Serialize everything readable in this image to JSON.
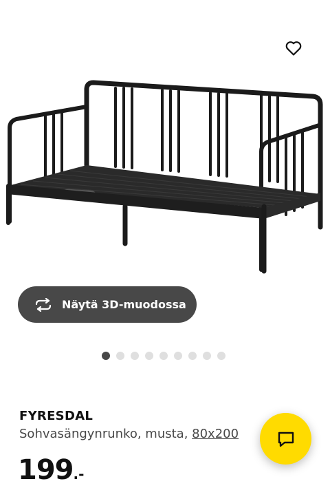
{
  "gallery": {
    "image_alt": "FYRESDAL sofa bed frame, black",
    "favourite_icon": "heart-outline-icon",
    "view_3d": {
      "icon": "rotate-3d-icon",
      "label": "Näytä 3D-muodossa"
    },
    "dots_total": 9,
    "active_dot": 1
  },
  "product": {
    "name": "FYRESDAL",
    "description": "Sohvasängynrunko, musta, ",
    "size": "80x200",
    "price_number": "199",
    "price_suffix": ".-"
  },
  "chat": {
    "icon": "chat-bubble-icon"
  },
  "colors": {
    "accent": "#ffdb00",
    "button": "#484848",
    "text": "#111111",
    "dot_inactive": "#dfdfdf"
  }
}
